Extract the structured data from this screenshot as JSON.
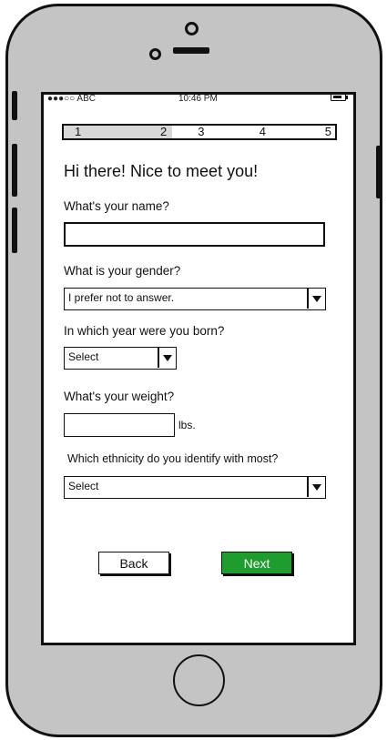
{
  "status_bar": {
    "carrier": "●●●○○ ABC",
    "time": "10:46 PM"
  },
  "stepper": {
    "steps": [
      "1",
      "2",
      "3",
      "4",
      "5"
    ],
    "current_step": 2
  },
  "form": {
    "title": "Hi there! Nice to meet you!",
    "name_label": "What's your name?",
    "name_value": "",
    "gender_label": "What is your gender?",
    "gender_value": "I prefer not to answer.",
    "year_label": "In which year were you born?",
    "year_value": "Select",
    "weight_label": "What's your weight?",
    "weight_value": "",
    "weight_unit": "lbs.",
    "ethnicity_label": "Which ethnicity do you identify with most?",
    "ethnicity_value": "Select"
  },
  "buttons": {
    "back": "Back",
    "next": "Next"
  },
  "colors": {
    "next_button": "#1e9c2e",
    "phone_body": "#c4c4c4"
  }
}
